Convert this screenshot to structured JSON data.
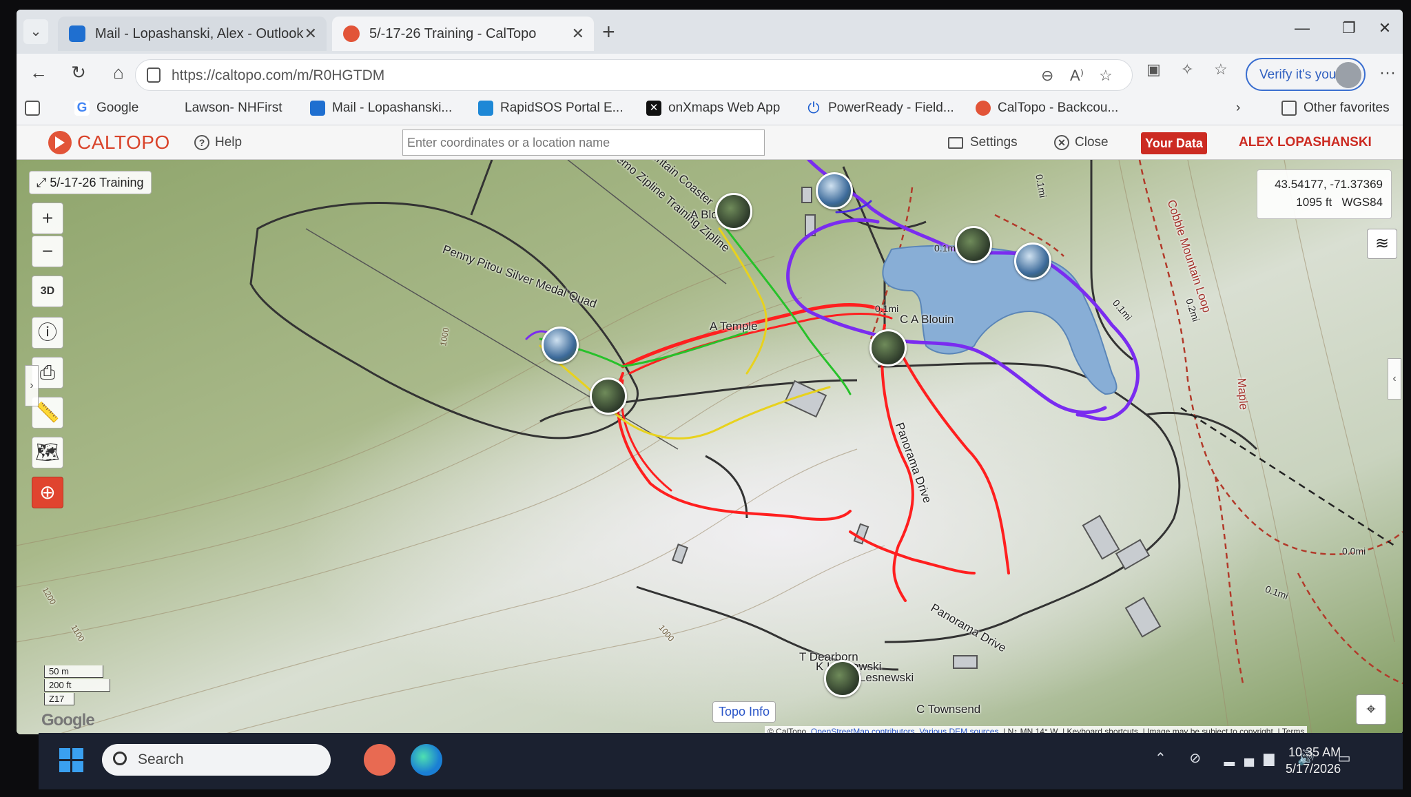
{
  "browser": {
    "tabs": [
      {
        "title": "Mail - Lopashanski, Alex - Outlook",
        "icon": "outlook-icon"
      },
      {
        "title": "5/-17-26 Training - CalTopo",
        "icon": "caltopo-icon"
      }
    ],
    "url": "https://caltopo.com/m/R0HGTDM",
    "verify_label": "Verify it's you",
    "favorites": [
      {
        "label": "Google"
      },
      {
        "label": "Lawson- NHFirst"
      },
      {
        "label": "Mail - Lopashanski..."
      },
      {
        "label": "RapidSOS Portal E..."
      },
      {
        "label": "onXmaps Web App"
      },
      {
        "label": "PowerReady - Field..."
      },
      {
        "label": "CalTopo - Backcou..."
      }
    ],
    "other_favorites": "Other favorites"
  },
  "caltopo": {
    "logo": "CALTOPO",
    "help": "Help",
    "search_placeholder": "Enter coordinates or a location name",
    "settings": "Settings",
    "close": "Close",
    "your_data": "Your Data",
    "user": "ALEX LOPASHANSKI"
  },
  "map": {
    "trip_label": "5/-17-26 Training",
    "coords": "43.54177, -71.37369",
    "elevation": "1095 ft",
    "datum": "WGS84",
    "controls": {
      "zoom_in": "+",
      "zoom_out": "−",
      "three_d": "3D"
    },
    "scale": [
      "50 m",
      "200 ft",
      "Z17"
    ],
    "topo_info": "Topo Info",
    "google": "Google",
    "attribution": {
      "caltopo": "© CalTopo,",
      "osm": "OpenStreetMap contributors,",
      "dem": "Various DEM sources",
      "mn": "N↑ MN 14° W",
      "shortcuts": "Keyboard shortcuts",
      "copyright": "Image may be subject to copyright",
      "terms": "Terms"
    },
    "labels": {
      "quad": "Penny Pitou Silver Medal Quad",
      "zipline": "Demo Zipline Training Zipline",
      "coaster": "Mountain Coaster",
      "a_blouin_top": "A Blouin",
      "a_temple": "A Temple",
      "c_a_blouin": "C A Blouin",
      "t_dearborn": "T Dearborn",
      "k_lesnewski": "K Lesnewski",
      "m_lesnewski": "M Lesnewski",
      "c_townsend": "C Townsend",
      "panorama_drive": "Panorama Drive",
      "panorama_drive_2": "Panorama Drive",
      "cobble_loop": "Cobble Mountain Loop",
      "maple": "Maple",
      "dist_01_a": "0.1mi",
      "dist_01_b": "0.1mi",
      "dist_01_c": "0.1mi",
      "dist_02": "0.2mi",
      "dist_00": "0.0mi",
      "dist_01_d": "0.1mi",
      "dist_01_e": "0.1mi",
      "contour_1000": "1000",
      "contour_1000_b": "1000",
      "contour_1200": "1200",
      "contour_1100": "1100"
    }
  },
  "taskbar": {
    "search": "Search",
    "time": "10:35 AM",
    "date": "5/17/2026"
  },
  "colors": {
    "track_red": "#ff1f1f",
    "track_purple": "#7a2cf0",
    "track_green": "#27c12a",
    "track_yellow": "#e8d21e",
    "water": "#88aed6",
    "caltopo_red": "#d9432a"
  }
}
